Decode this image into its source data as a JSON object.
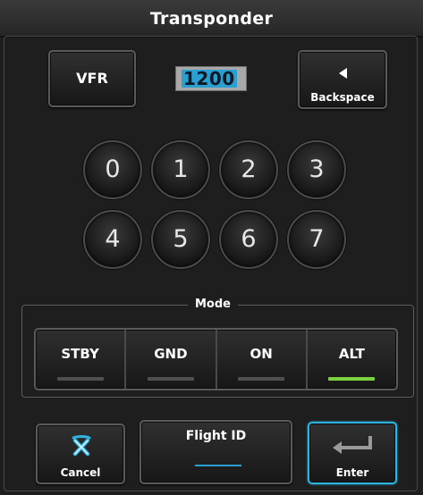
{
  "title": "Transponder",
  "vfr_button": {
    "label": "VFR"
  },
  "squawk": {
    "code": "1200"
  },
  "backspace_button": {
    "label": "Backspace",
    "icon": "left-arrow-icon"
  },
  "keypad": {
    "keys": [
      "0",
      "1",
      "2",
      "3",
      "4",
      "5",
      "6",
      "7"
    ]
  },
  "mode": {
    "label": "Mode",
    "buttons": [
      {
        "label": "STBY",
        "active": false
      },
      {
        "label": "GND",
        "active": false
      },
      {
        "label": "ON",
        "active": false
      },
      {
        "label": "ALT",
        "active": true
      }
    ]
  },
  "bottom": {
    "cancel_label": "Cancel",
    "cancel_icon": "cancel-x-icon",
    "flight_id_label": "Flight ID",
    "enter_label": "Enter",
    "enter_icon": "enter-arrow-icon"
  },
  "colors": {
    "accent_cyan": "#2fb4e0",
    "indicator_active": "#7bd13b",
    "indicator_inactive": "#505050",
    "code_highlight": "#2a9fd0"
  }
}
